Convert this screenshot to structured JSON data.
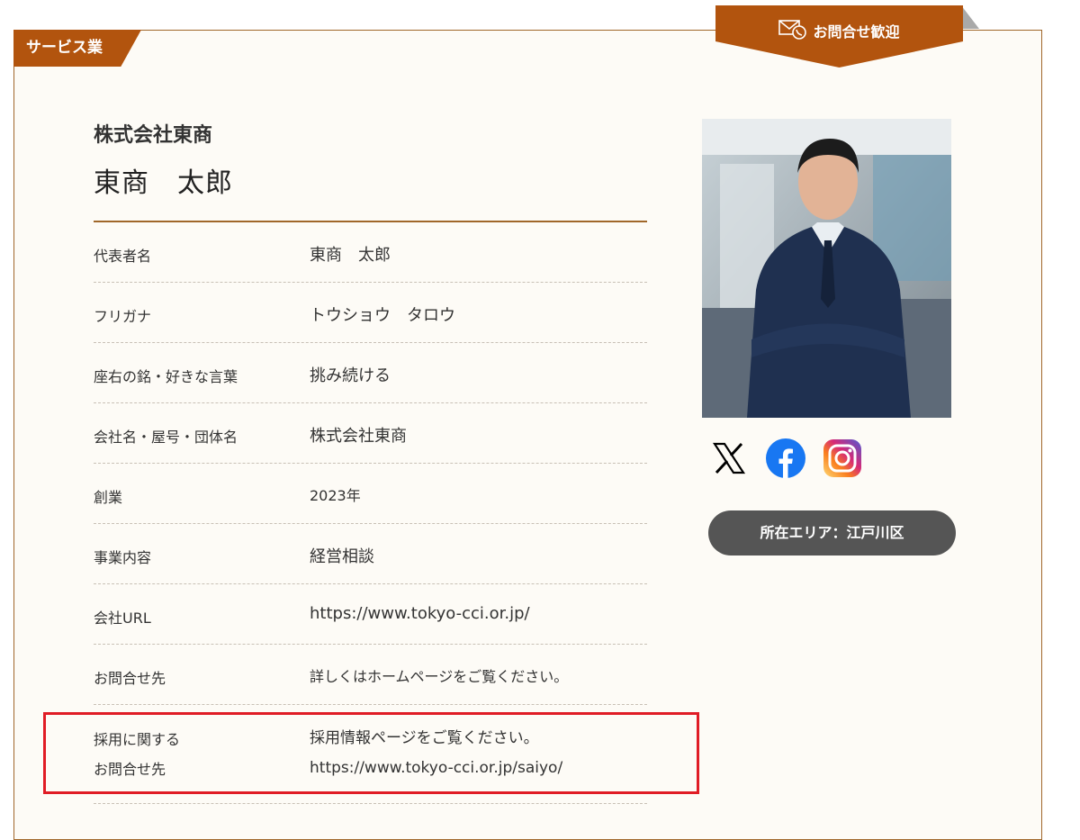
{
  "category": "サービス業",
  "contact_banner": "お問合せ歓迎",
  "company_name": "株式会社東商",
  "person_name": "東商　太郎",
  "rows": [
    {
      "label": "代表者名",
      "value": "東商　太郎"
    },
    {
      "label": "フリガナ",
      "value": "トウショウ　タロウ"
    },
    {
      "label": "座右の銘・好きな言葉",
      "value": "挑み続ける"
    },
    {
      "label": "会社名・屋号・団体名",
      "value": "株式会社東商"
    },
    {
      "label": "創業",
      "value": "2023年"
    },
    {
      "label": "事業内容",
      "value": "経営相談"
    },
    {
      "label": "会社URL",
      "value": "https://www.tokyo-cci.or.jp/"
    },
    {
      "label": "お問合せ先",
      "value": "詳しくはホームページをご覧ください。"
    }
  ],
  "recruit": {
    "label_line1": "採用に関する",
    "label_line2": "お問合せ先",
    "value_line1": "採用情報ページをご覧ください。",
    "value_line2": "https://www.tokyo-cci.or.jp/saiyo/"
  },
  "social_icons": [
    "x-icon",
    "facebook-icon",
    "instagram-icon"
  ],
  "area": "所在エリア：江戸川区",
  "colors": {
    "accent": "#b2540e",
    "highlight": "#e01c25",
    "pill": "#555555"
  }
}
